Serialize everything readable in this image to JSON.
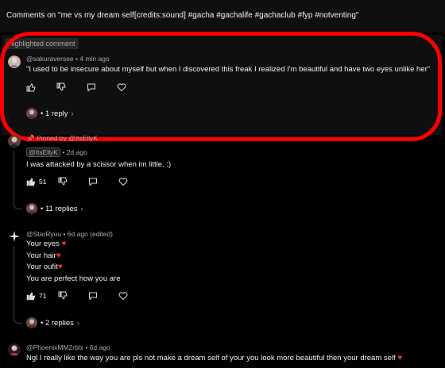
{
  "header": {
    "title": "Comments on \"me vs my dream self[credits:sound] #gacha #gachalife #gachaclub #fyp #notventing\""
  },
  "highlight": {
    "label": "Highlighted comment",
    "comment": {
      "handle": "@sakuraversee",
      "time": "• 4 min ago",
      "text": "\"I used to be insecure about myself but when I discovered this freak I realized I'm beautiful and have two eyes unlike her\"",
      "replies_label": "• 1 reply"
    }
  },
  "comments": [
    {
      "pinned": "Pinned by @ItsEllyK",
      "handle": "@ItsEllyK",
      "time": "• 2d ago",
      "lines": [
        "I was attacked by a scissor when im little. :)"
      ],
      "likes": "51",
      "replies_label": "• 11 replies"
    },
    {
      "handle": "@StarRyuu",
      "time": "• 6d ago (edited)",
      "lines": [
        "Your eyes",
        "Your hair",
        "Your oufit",
        "You are perfect how you are"
      ],
      "likes": "71",
      "replies_label": "• 2 replies"
    },
    {
      "handle": "@PhoenixMM2rblx",
      "time": "• 6d ago",
      "lines": [
        "Ngl I really like the way you are pls not make a dream self of your you look more beautiful then your dream self"
      ]
    }
  ],
  "colors": {
    "highlight_ring": "#ff0000",
    "heart": "#e4352f",
    "background": "#000000",
    "panel": "#0f0f0f"
  },
  "icons": {
    "like": "thumbs-up-icon",
    "dislike": "thumbs-down-icon",
    "reply": "reply-bubble-icon",
    "heart": "heart-icon",
    "pin": "pin-icon",
    "chevron": "chevron-right-icon"
  }
}
